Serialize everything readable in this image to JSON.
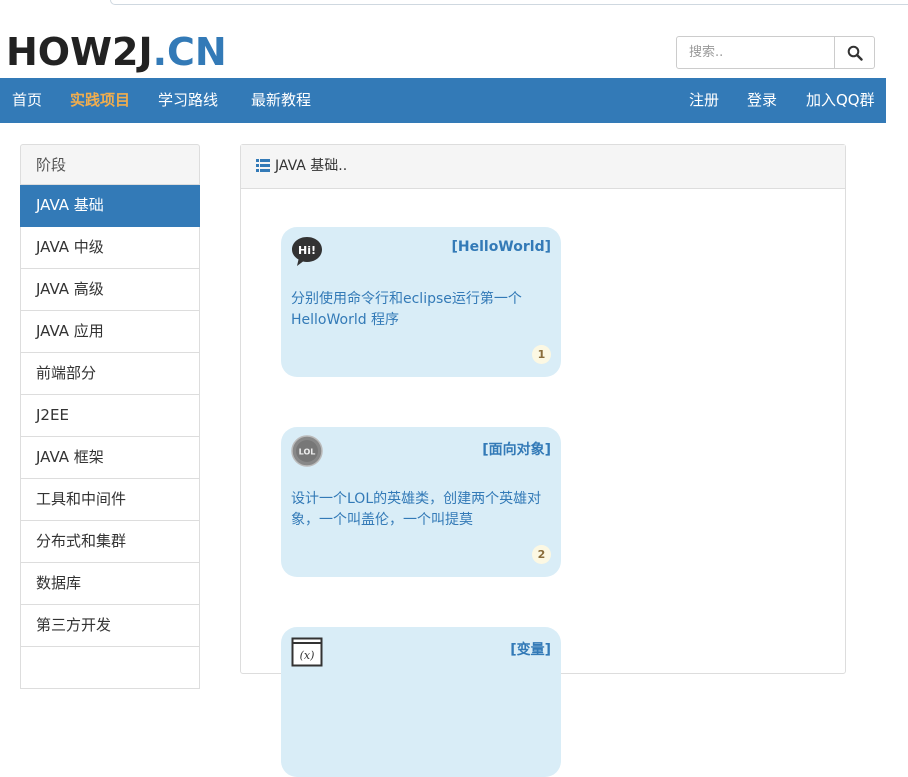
{
  "logo": {
    "part1": "HOW2J",
    "part2": ".CN"
  },
  "search": {
    "placeholder": "搜索.."
  },
  "nav": {
    "left": [
      "首页",
      "实践项目",
      "学习路线",
      "最新教程"
    ],
    "active": "实践项目",
    "right": [
      "注册",
      "登录",
      "加入QQ群"
    ]
  },
  "sidebar": {
    "title": "阶段",
    "items": [
      "JAVA 基础",
      "JAVA 中级",
      "JAVA 高级",
      "JAVA 应用",
      "前端部分",
      "J2EE",
      "JAVA 框架",
      "工具和中间件",
      "分布式和集群",
      "数据库",
      "第三方开发"
    ],
    "active": "JAVA 基础"
  },
  "panel": {
    "title": "JAVA 基础.."
  },
  "cards": [
    {
      "icon": "speech-bubble-hi-icon",
      "icon_text": "Hi!",
      "title": "[HelloWorld]",
      "desc": "分别使用命令行和eclipse运行第一个HelloWorld 程序",
      "badge": "1"
    },
    {
      "icon": "lol-hero-icon",
      "icon_text": "LOL",
      "title": "[面向对象]",
      "desc": "设计一个LOL的英雄类，创建两个英雄对象，一个叫盖伦，一个叫提莫",
      "badge": "2"
    },
    {
      "icon": "variable-x-icon",
      "icon_text": "(x)",
      "title": "[变量]",
      "desc": "",
      "badge": ""
    }
  ],
  "colors": {
    "primary": "#337ab7",
    "active_nav": "#f0ad4e",
    "card_bg": "#d9edf7",
    "badge_bg": "#fcf8e3"
  }
}
